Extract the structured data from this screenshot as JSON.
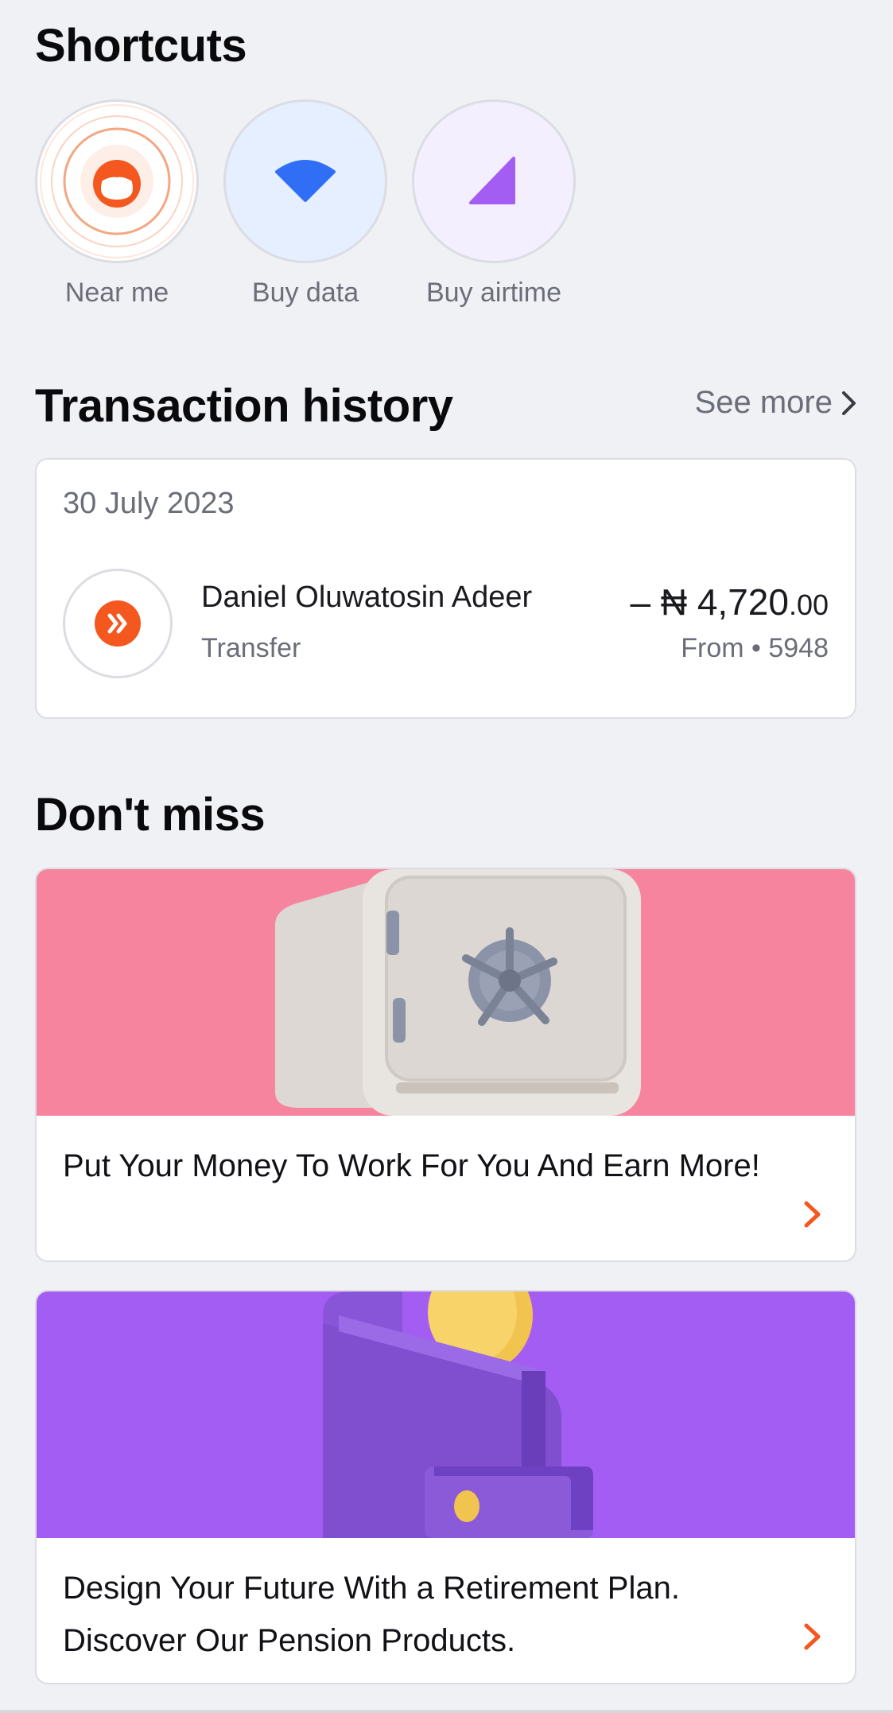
{
  "shortcuts": {
    "title": "Shortcuts",
    "items": [
      {
        "label": "Near me",
        "icon": "face-icon",
        "bg": "#ffffff",
        "accent": "#f4581f"
      },
      {
        "label": "Buy data",
        "icon": "wifi-icon",
        "bg": "#e6efff",
        "accent": "#2f6ef5"
      },
      {
        "label": "Buy airtime",
        "icon": "signal-icon",
        "bg": "#f3efff",
        "accent": "#a45df3"
      }
    ]
  },
  "transactions": {
    "title": "Transaction history",
    "see_more": "See more",
    "date": "30 July 2023",
    "item": {
      "name": "Daniel Oluwatosin Adeer",
      "type": "Transfer",
      "amount_main": "– ₦ 4,720",
      "amount_cents": ".00",
      "source": "From • 5948",
      "icon": "transfer-icon",
      "accent": "#f4581f"
    }
  },
  "dont_miss": {
    "title": "Don't miss",
    "promos": [
      {
        "text": "Put Your Money To Work For You And Earn More!",
        "banner_color": "#f7849f",
        "image": "safe-illustration"
      },
      {
        "text": "Design Your Future With a Retirement Plan. Discover Our Pension Products.",
        "banner_color": "#a45df3",
        "image": "wallet-coin-illustration"
      }
    ]
  },
  "colors": {
    "background": "#f0f1f5",
    "accent": "#f4581f",
    "muted_text": "#6b6e78"
  }
}
